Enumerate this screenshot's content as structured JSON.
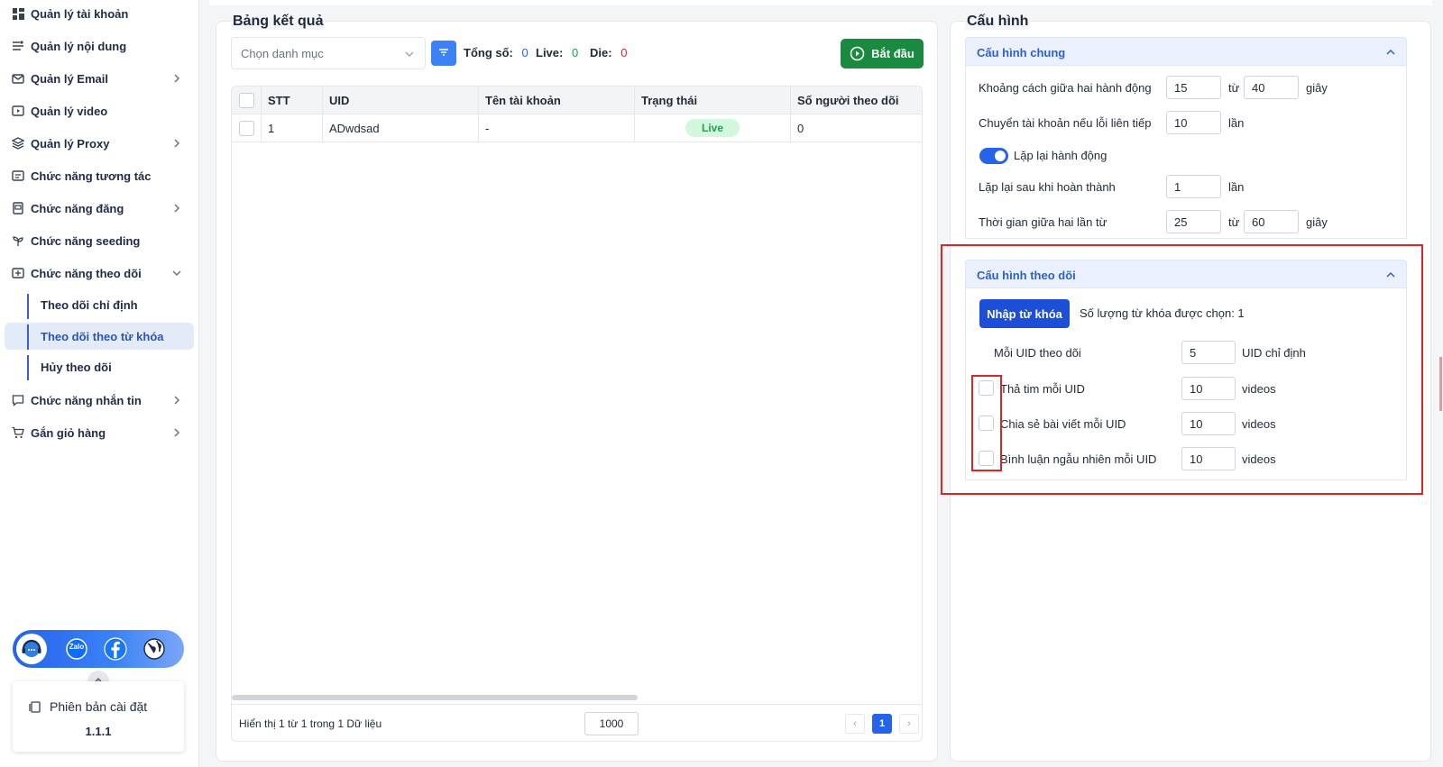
{
  "sidebar": {
    "items": [
      {
        "label": "Quản lý tài khoản",
        "icon": "dashboard-icon",
        "has_chevron": false
      },
      {
        "label": "Quản lý nội dung",
        "icon": "content-icon",
        "has_chevron": false
      },
      {
        "label": "Quản lý Email",
        "icon": "mail-icon",
        "has_chevron": true
      },
      {
        "label": "Quản lý video",
        "icon": "video-icon",
        "has_chevron": false
      },
      {
        "label": "Quản lý Proxy",
        "icon": "layers-icon",
        "has_chevron": true
      },
      {
        "label": "Chức năng tương tác",
        "icon": "interact-icon",
        "has_chevron": false
      },
      {
        "label": "Chức năng đăng",
        "icon": "post-icon",
        "has_chevron": true
      },
      {
        "label": "Chức năng seeding",
        "icon": "seeding-icon",
        "has_chevron": false
      },
      {
        "label": "Chức năng theo dõi",
        "icon": "follow-icon",
        "has_chevron": true
      },
      {
        "label": "Chức năng nhắn tin",
        "icon": "chat-icon",
        "has_chevron": true
      },
      {
        "label": "Gắn giỏ hàng",
        "icon": "cart-icon",
        "has_chevron": true
      }
    ],
    "sub_items": [
      {
        "label": "Theo dõi chỉ định",
        "active": false
      },
      {
        "label": "Theo dõi theo từ khóa",
        "active": true
      },
      {
        "label": "Hủy theo dõi",
        "active": false
      }
    ],
    "social": [
      "support-icon",
      "zalo-icon",
      "facebook-icon",
      "globe-icon"
    ],
    "zalo_text": "Zalo",
    "version_title": "Phiên bản cài đặt",
    "version_number": "1.1.1"
  },
  "results": {
    "title": "Bảng kết quả",
    "select_placeholder": "Chọn danh mục",
    "total_label": "Tổng số:",
    "total_value": "0",
    "live_label": "Live:",
    "live_value": "0",
    "die_label": "Die:",
    "die_value": "0",
    "start_label": "Bắt đầu",
    "columns": [
      "STT",
      "UID",
      "Tên tài khoản",
      "Trạng thái",
      "Số người theo dõi"
    ],
    "rows": [
      {
        "stt": "1",
        "uid": "ADwdsad",
        "name": "-",
        "status": "Live",
        "followers": "0"
      }
    ],
    "footer_text": "Hiển thị 1 từ 1 trong 1 Dữ liệu",
    "page_size": "1000",
    "current_page": "1",
    "prev": "‹",
    "next": "›"
  },
  "config": {
    "title": "Cấu hình",
    "general": {
      "title": "Cấu hình chung",
      "interval_label": "Khoảng cách giữa hai hành động",
      "interval_from": "15",
      "interval_to": "40",
      "tu": "từ",
      "giay": "giây",
      "switch_label": "Chuyển tài khoản nếu lỗi liên tiếp",
      "switch_value": "10",
      "lan": "lần",
      "repeat_toggle_label": "Lặp lại hành động",
      "repeat_toggle_on": true,
      "repeat_after_label": "Lặp lại sau khi hoàn thành",
      "repeat_after_value": "1",
      "between_label": "Thời gian giữa hai lần từ",
      "between_from": "25",
      "between_to": "60"
    },
    "follow": {
      "title": "Cấu hình theo dõi",
      "import_button": "Nhập từ khóa",
      "selected_count_label": "Số lượng từ khóa được chọn: 1",
      "per_uid_label": "Mỗi UID theo dõi",
      "per_uid_value": "5",
      "per_uid_unit": "UID chỉ định",
      "options": [
        {
          "label": "Thả tim mỗi UID",
          "value": "10",
          "unit": "videos",
          "checked": false
        },
        {
          "label": "Chia sẻ bài viết mỗi UID",
          "value": "10",
          "unit": "videos",
          "checked": false
        },
        {
          "label": "Bình luận ngẫu nhiên mỗi UID",
          "value": "10",
          "unit": "videos",
          "checked": false
        }
      ]
    }
  },
  "colors": {
    "primary": "#2563eb",
    "start_button": "#198a3f",
    "highlight_box": "#e02424",
    "live_badge_bg": "#d1f7dc",
    "live_badge_text": "#22a14d",
    "total_value": "#2563eb",
    "live_value": "#16a34a",
    "die_value": "#dc2626"
  }
}
